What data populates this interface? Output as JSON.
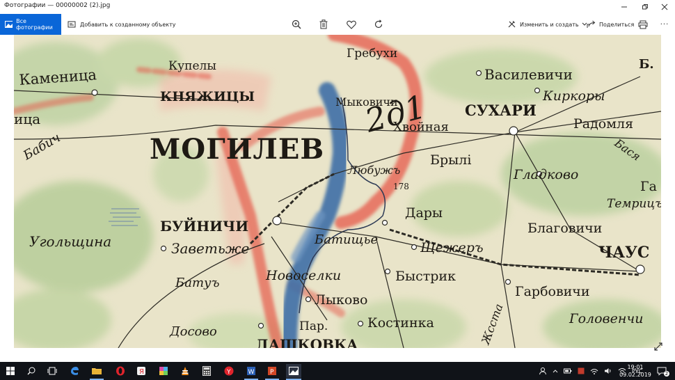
{
  "window": {
    "title": "Фотографии — 00000002 (2).jpg"
  },
  "toolbar": {
    "all_photos": "Все фотографии",
    "add_to_creation": "Добавить к созданному объекту",
    "edit_create": "Изменить и создать",
    "share": "Поделиться",
    "more": "···"
  },
  "map": {
    "labels": {
      "mogilev": "МОГИЛЕВ",
      "knyazhitsy": "КНЯЖИЦЫ",
      "kamenitsa": "Каменица",
      "buinichi": "БУЙНИЧИ",
      "zavetye": "Заветьже",
      "ugolshchina": "Угольщина",
      "baty": "Батуъ",
      "dosovo": "Досово",
      "novoselki": "Новоселки",
      "lykovo": "Лыково",
      "kostinka": "Костинка",
      "bystrik": "Быстрик",
      "shchezhe": "Щежеръ",
      "dary": "Дары",
      "bryli": "Брылi",
      "sukhari": "СУХАРИ",
      "vasilevichi": "Василевичи",
      "kirkory": "Киркоры",
      "radomlya": "Радомля",
      "gladkovo": "Гладково",
      "temrits": "Темрицъ",
      "blagovichi": "Благовичи",
      "chaus": "ЧАУС",
      "garbovichi": "Гарбовичи",
      "golovenchi": "Головенчи",
      "grebukhi": "Гребухи",
      "mikovichi": "Мыковичи",
      "khvoynaya": "Хвойная",
      "babich": "Бабич",
      "dashkovka": "ДАШКОВКА",
      "batishche": "Батищье",
      "par": "Пар.",
      "kupely": "Купелы",
      "tsa": "ица",
      "ga": "Га",
      "b": "Б.",
      "basya": "Бася",
      "lyubuzh": "Любужъ",
      "mark178": "178",
      "handwriting": "2д1",
      "sosna": "Жсста"
    }
  },
  "taskbar": {
    "language": "РУС",
    "time": "19:01",
    "date": "09.02.2019",
    "notifications": "2"
  }
}
